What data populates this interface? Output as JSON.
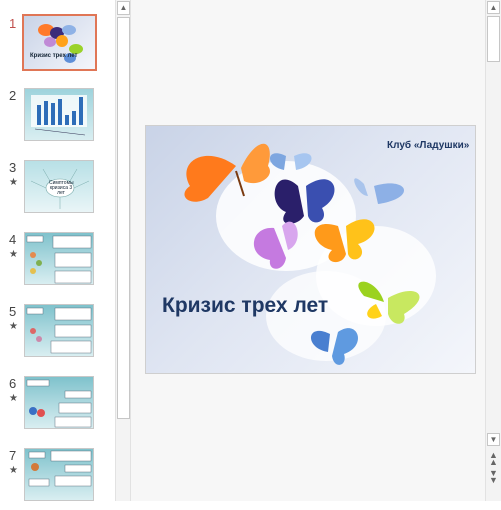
{
  "slides": [
    {
      "num": "1",
      "star": "",
      "active": true
    },
    {
      "num": "2",
      "star": "",
      "active": false
    },
    {
      "num": "3",
      "star": "★",
      "active": false
    },
    {
      "num": "4",
      "star": "★",
      "active": false
    },
    {
      "num": "5",
      "star": "★",
      "active": false
    },
    {
      "num": "6",
      "star": "★",
      "active": false
    },
    {
      "num": "7",
      "star": "★",
      "active": false
    }
  ],
  "slide1_thumb_title": "Кризис трех лет",
  "slide3_thumb_title": "Симптомы кризиса 3 лет",
  "main": {
    "club": "Клуб «Ладушки»",
    "title": "Кризис трех лет"
  },
  "colors": {
    "accent": "#c0504d",
    "title": "#1f3864"
  }
}
